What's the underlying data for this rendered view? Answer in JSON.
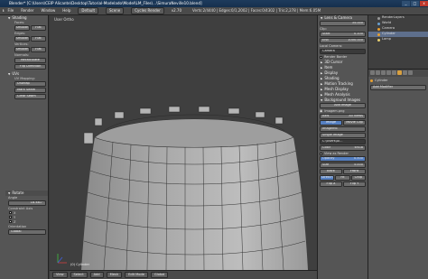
{
  "title": "Blender* [C:\\Users\\CEIP Alicante\\Desktop\\Tutorial-Modelado\\Model\\LM_Files\\...\\SimuraNeville10.blend]",
  "window_buttons": [
    "_",
    "□",
    "x"
  ],
  "menu": {
    "items": [
      "File",
      "Render",
      "Window",
      "Help"
    ],
    "layout": "Default",
    "scene": "Scene",
    "engine": "Cycles Render",
    "version": "v2.70",
    "stats": "Verts:2/4440 | Edges:0/1,2002 | Faces:0/4302 | Tris:2,278 | Mem:6.05M"
  },
  "toolshelf": {
    "shading": {
      "header": "Shading",
      "faces_label": "Faces:",
      "faces_buttons": [
        "Smooth",
        "Flat"
      ],
      "edges_label": "Edges:",
      "edges_buttons": [
        "Smooth",
        "Flat"
      ],
      "vertices_label": "Vertices:",
      "vertices_buttons": [
        "Smooth",
        "Flat"
      ],
      "normals_label": "Normals:",
      "normals_buttons": [
        "Recalculate",
        "Flip Direction"
      ]
    },
    "uvs": {
      "header": "UVs",
      "mapping_label": "UV Mapping:",
      "unwrap": "Unwrap",
      "mark_seam": "Mark Seam",
      "clear_seam": "Clear Seam"
    },
    "operator": {
      "header": "Rotate",
      "angle_label": "Angle",
      "angle_value": "18.481°",
      "constraint_label": "Constraint Axis",
      "axes": [
        "X",
        "Y",
        "Z"
      ],
      "orientation_label": "Orientation",
      "orientation_value": "Global"
    }
  },
  "viewport": {
    "label": "User Ortho",
    "object_label": "(0) Cylinder"
  },
  "viewport_header": {
    "view": "View",
    "select": "Select",
    "add": "Add",
    "mesh": "Mesh",
    "mode": "Edit Mode",
    "pivot": "Global"
  },
  "npanel": {
    "lens": {
      "header": "Lens & Camera",
      "value": "35.000"
    },
    "clip": {
      "label": "Clip:",
      "start_label": "Start",
      "start_value": "0.100",
      "end_label": "End",
      "end_value": "1000.000",
      "local_camera": "Local Camera:",
      "camera": "Camera"
    },
    "render_border": "Render Border",
    "panels": [
      "3D Cursor",
      "Item",
      "Display",
      "Shading",
      "Motion Tracking",
      "Mesh Display",
      "Mesh Analysis"
    ],
    "background_images": {
      "header": "Background Images",
      "add_image": "Add Image",
      "image_name": "Imagem.png",
      "axis_label": "Axis",
      "axis_value": "All Views",
      "buttons": [
        "Image",
        "Movie Clip"
      ],
      "file": "Imagem6",
      "source": "Single Image",
      "path": "C:\\Users\\Al...",
      "color_label": "Color",
      "color_value": "sRGB",
      "view_as_render": "View as Render",
      "opacity_label": "Opacity",
      "opacity_value": "0.500",
      "size_label": "Size",
      "size_value": "5.000",
      "front_back": [
        "Back",
        "Front"
      ],
      "stretch_fit": [
        "Stretch",
        "Fit",
        "Crop"
      ],
      "flip": [
        "Flip X",
        "Flip Y"
      ]
    }
  },
  "outliner": {
    "items": [
      "RenderLayers",
      "World",
      "Camera",
      "Cylinder",
      "Lamp"
    ]
  },
  "properties": {
    "object": "Cylinder",
    "add_modifier": "Add Modifier"
  },
  "colors": {
    "accent": "#5680c2",
    "bg": "#3f3f3f",
    "panel": "#555555",
    "select": "#e8a030"
  }
}
